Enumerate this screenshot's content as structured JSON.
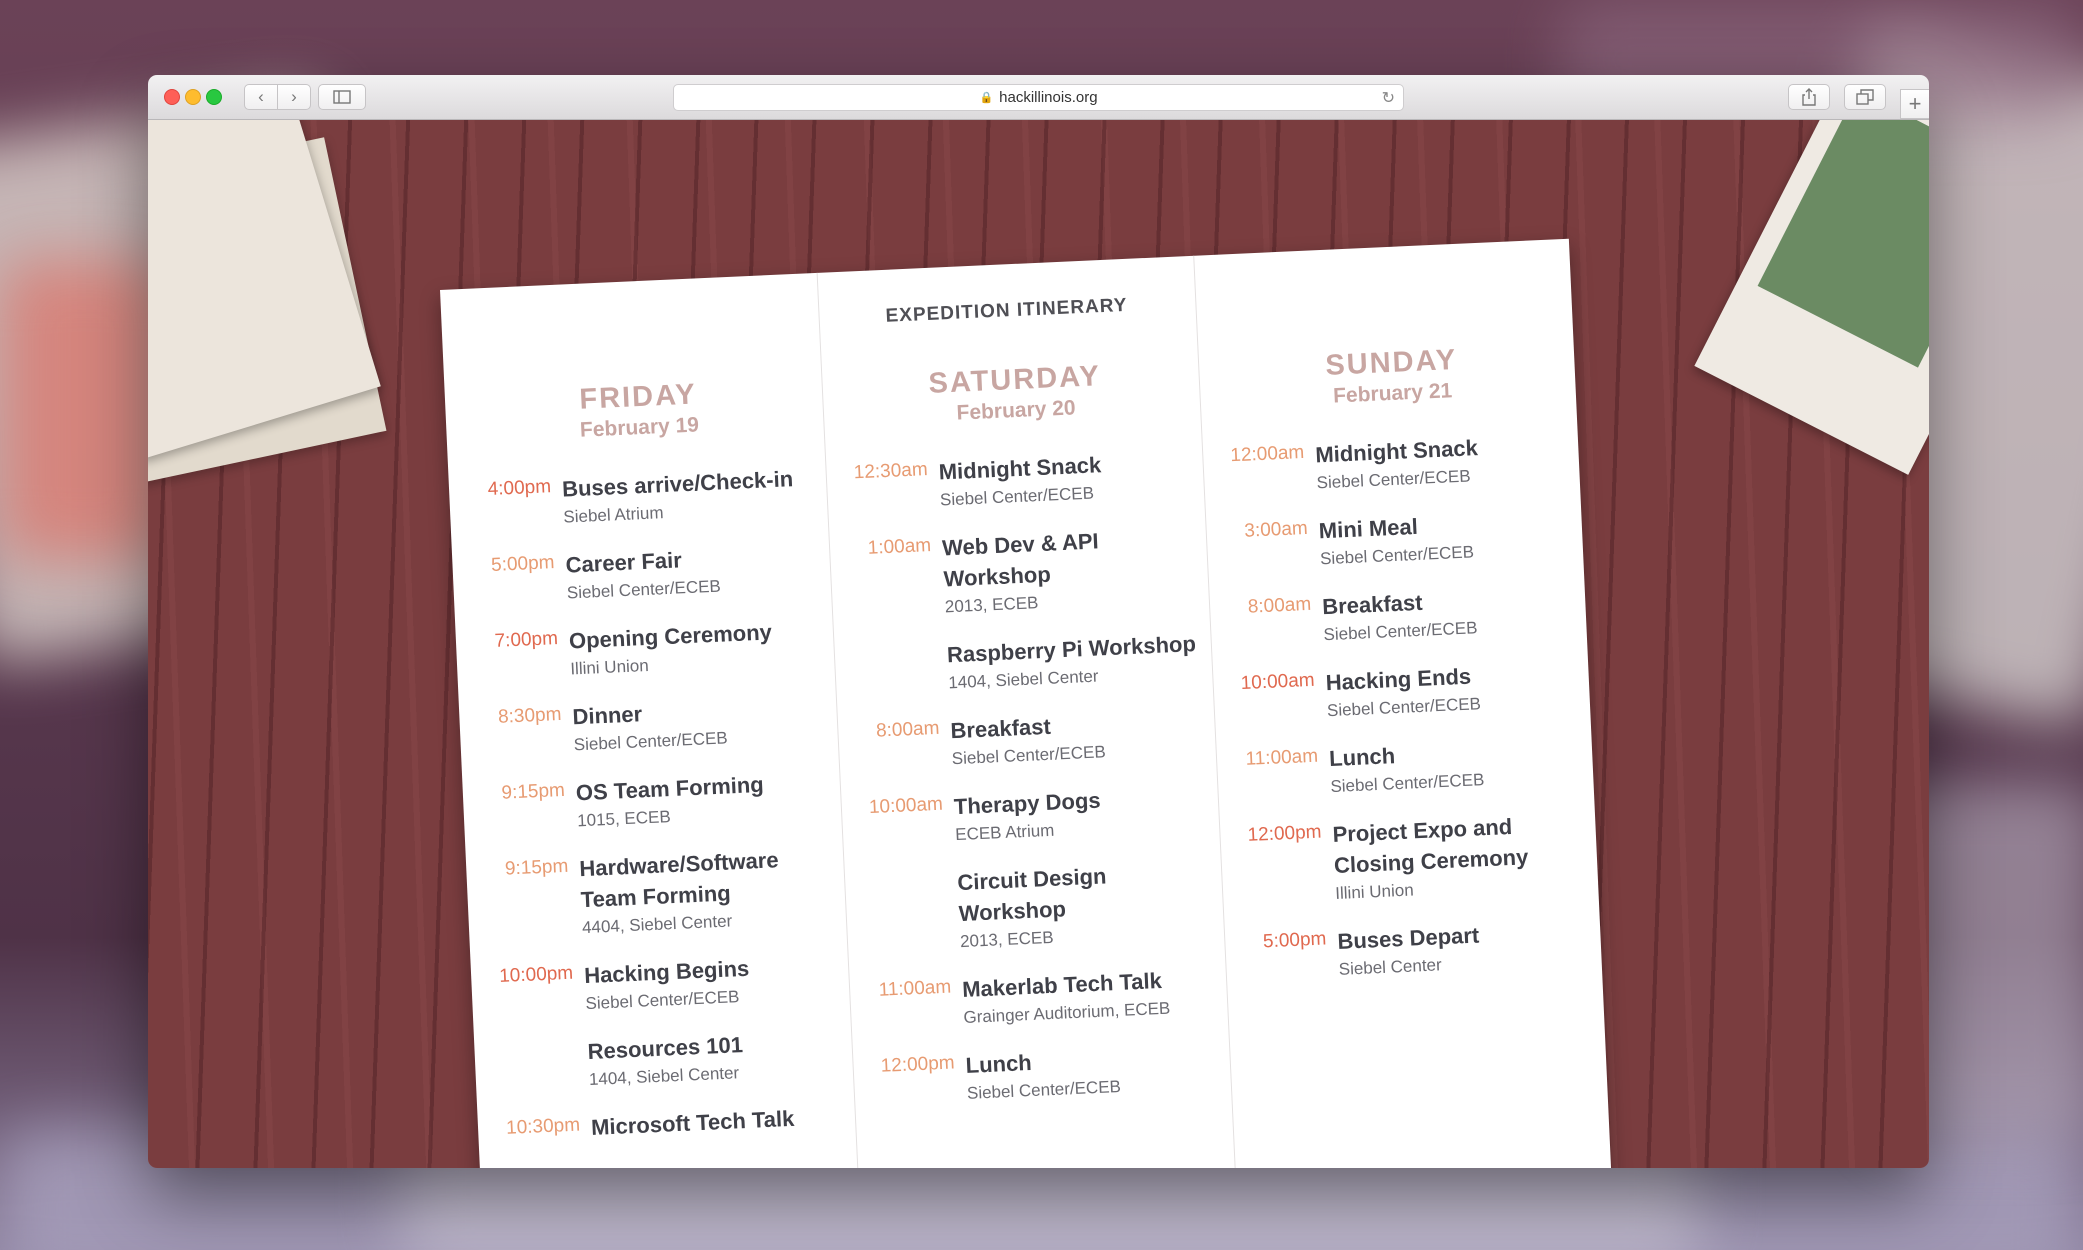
{
  "browser": {
    "url": "hackillinois.org"
  },
  "sheet_title": "EXPEDITION ITINERARY",
  "days": [
    {
      "day": "FRIDAY",
      "date": "February 19",
      "events": [
        {
          "time": "4:00pm",
          "name": "Buses arrive/Check-in",
          "location": "Siebel Atrium"
        },
        {
          "time": "5:00pm",
          "name": "Career Fair",
          "location": "Siebel Center/ECEB"
        },
        {
          "time": "7:00pm",
          "name": "Opening Ceremony",
          "location": "Illini Union"
        },
        {
          "time": "8:30pm",
          "name": "Dinner",
          "location": "Siebel Center/ECEB"
        },
        {
          "time": "9:15pm",
          "name": "OS Team Forming",
          "location": "1015, ECEB"
        },
        {
          "time": "9:15pm",
          "name": "Hardware/Software Team Forming",
          "location": "4404, Siebel Center"
        },
        {
          "time": "10:00pm",
          "name": "Hacking Begins",
          "location": "Siebel Center/ECEB"
        },
        {
          "time": "",
          "name": "Resources 101",
          "location": "1404, Siebel Center"
        },
        {
          "time": "10:30pm",
          "name": "Microsoft Tech Talk",
          "location": ""
        }
      ]
    },
    {
      "day": "SATURDAY",
      "date": "February 20",
      "events": [
        {
          "time": "12:30am",
          "name": "Midnight Snack",
          "location": "Siebel Center/ECEB"
        },
        {
          "time": "1:00am",
          "name": "Web Dev & API Workshop",
          "location": "2013, ECEB"
        },
        {
          "time": "",
          "name": "Raspberry Pi Workshop",
          "location": "1404, Siebel Center"
        },
        {
          "time": "8:00am",
          "name": "Breakfast",
          "location": "Siebel Center/ECEB"
        },
        {
          "time": "10:00am",
          "name": "Therapy Dogs",
          "location": "ECEB Atrium"
        },
        {
          "time": "",
          "name": "Circuit Design Workshop",
          "location": "2013, ECEB"
        },
        {
          "time": "11:00am",
          "name": "Makerlab Tech Talk",
          "location": "Grainger Auditorium, ECEB"
        },
        {
          "time": "12:00pm",
          "name": "Lunch",
          "location": "Siebel Center/ECEB"
        }
      ]
    },
    {
      "day": "SUNDAY",
      "date": "February 21",
      "events": [
        {
          "time": "12:00am",
          "name": "Midnight Snack",
          "location": "Siebel Center/ECEB"
        },
        {
          "time": "3:00am",
          "name": "Mini Meal",
          "location": "Siebel Center/ECEB"
        },
        {
          "time": "8:00am",
          "name": "Breakfast",
          "location": "Siebel Center/ECEB"
        },
        {
          "time": "10:00am",
          "name": "Hacking Ends",
          "location": "Siebel Center/ECEB"
        },
        {
          "time": "11:00am",
          "name": "Lunch",
          "location": "Siebel Center/ECEB"
        },
        {
          "time": "12:00pm",
          "name": "Project Expo and Closing Ceremony",
          "location": "Illini Union"
        },
        {
          "time": "5:00pm",
          "name": "Buses Depart",
          "location": "Siebel Center"
        }
      ]
    }
  ],
  "colors": {
    "time_orange": "#e79b72",
    "time_red": "#e0694f",
    "day_heading": "#c8a6a2",
    "wood": "#7a3d3f"
  }
}
